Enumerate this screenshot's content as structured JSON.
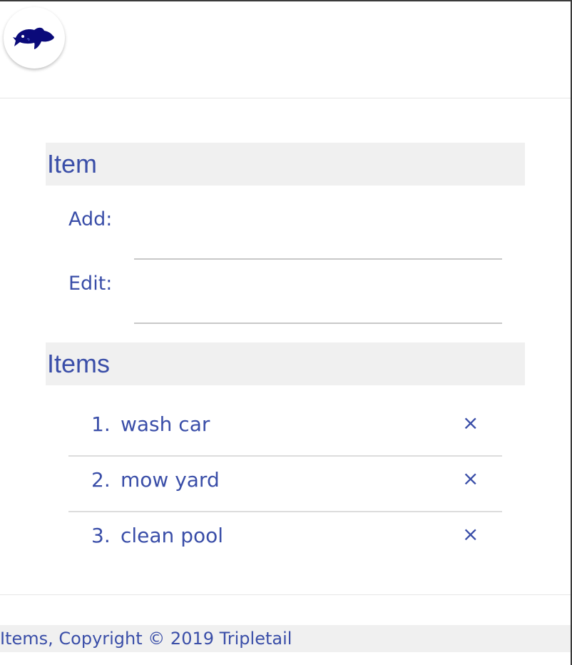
{
  "header": {
    "logo_icon": "fish-icon"
  },
  "item_section": {
    "title": "Item",
    "add_label": "Add:",
    "add_value": "",
    "edit_label": "Edit:",
    "edit_value": ""
  },
  "items_section": {
    "title": "Items",
    "items": [
      {
        "number": "1.",
        "text": "wash car",
        "remove": "×"
      },
      {
        "number": "2.",
        "text": "mow yard",
        "remove": "×"
      },
      {
        "number": "3.",
        "text": "clean pool",
        "remove": "×"
      }
    ]
  },
  "footer": {
    "text": "Items, Copyright © 2019 Tripletail"
  },
  "colors": {
    "text": "#3a4ea8",
    "section_bg": "#f0f0f0",
    "logo": "#0a0a7a"
  }
}
